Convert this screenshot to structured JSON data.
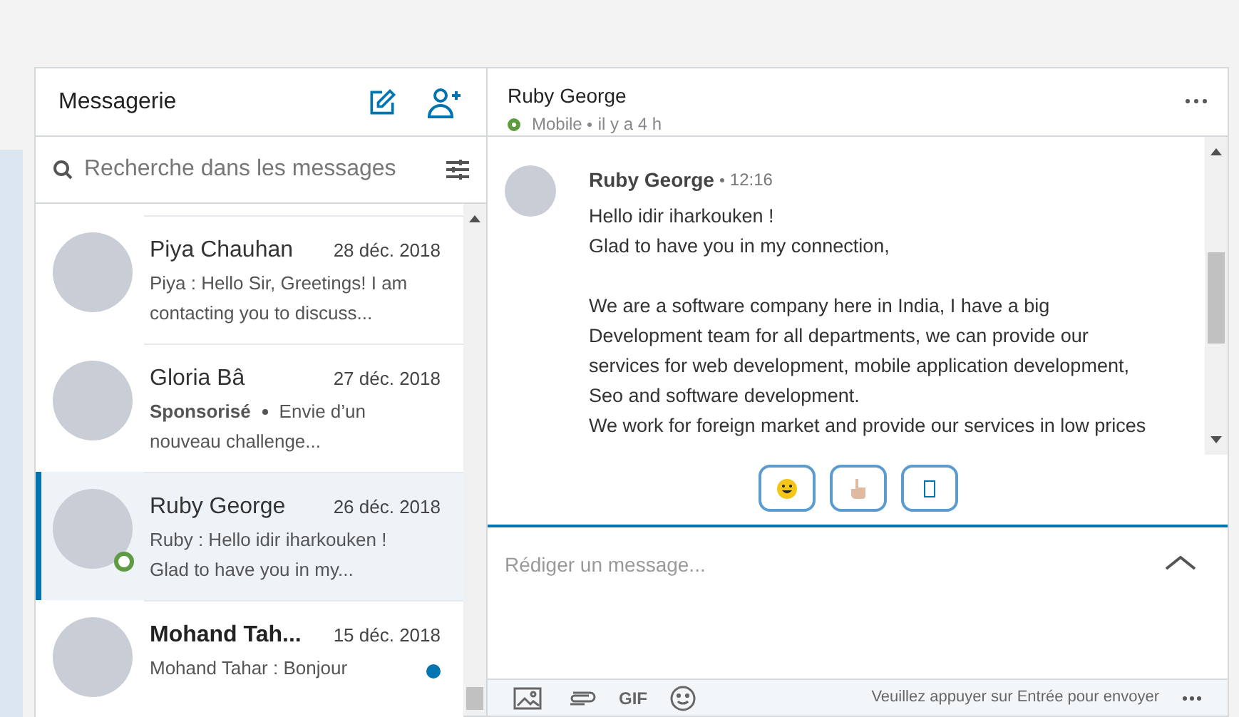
{
  "sidebar": {
    "title": "Messagerie",
    "search": {
      "placeholder": "Recherche dans les messages"
    },
    "conversations": [
      {
        "name": "Piya Chauhan",
        "date": "28 déc. 2018",
        "preview": [
          "Piya : Hello Sir, Greetings! I am",
          "contacting you to discuss..."
        ],
        "selected": false,
        "online": false,
        "unread": false
      },
      {
        "name": "Gloria Bâ",
        "date": "27 déc. 2018",
        "preview": [
          "Envie d’un",
          "nouveau challenge..."
        ],
        "selected": false,
        "online": false,
        "unread": false,
        "sponsored": "Sponsorisé"
      },
      {
        "name": "Ruby George",
        "date": "26 déc. 2018",
        "preview": [
          "Ruby : Hello idir iharkouken !",
          "Glad to have you in my..."
        ],
        "selected": true,
        "online": true,
        "unread": false
      },
      {
        "name": "Mohand Tah...",
        "date": "15 déc. 2018",
        "preview": [
          "Mohand Tahar : Bonjour"
        ],
        "selected": false,
        "online": false,
        "unread": true
      }
    ]
  },
  "chat": {
    "name": "Ruby George",
    "device": "Mobile",
    "last_seen": "il y a 4 h",
    "online": true,
    "message": {
      "sender": "Ruby George",
      "time": "12:16",
      "paragraphs": [
        [
          "Hello idir iharkouken !",
          "Glad to have you in my connection,"
        ],
        [
          "We are a software company here in India, I have a big",
          "Development team for all departments, we can provide our",
          "services for web development, mobile application development,",
          "Seo and software development.",
          "We work for foreign market and provide our services in low prices"
        ]
      ]
    },
    "compose": {
      "placeholder": "Rédiger un message..."
    },
    "toolbar": {
      "gif": "GIF",
      "hint": "Veuillez appuyer sur Entrée pour envoyer"
    }
  }
}
